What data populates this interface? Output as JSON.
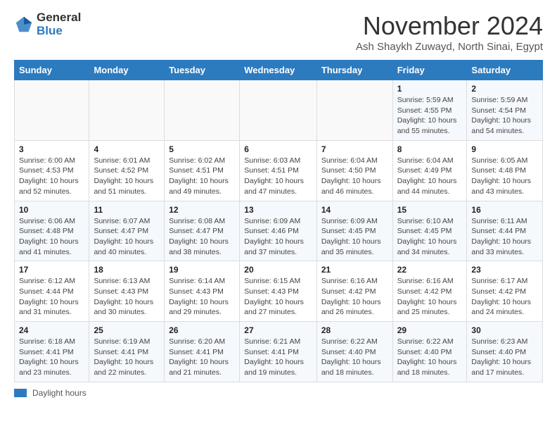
{
  "logo": {
    "general": "General",
    "blue": "Blue"
  },
  "title": "November 2024",
  "subtitle": "Ash Shaykh Zuwayd, North Sinai, Egypt",
  "weekdays": [
    "Sunday",
    "Monday",
    "Tuesday",
    "Wednesday",
    "Thursday",
    "Friday",
    "Saturday"
  ],
  "legend": {
    "box_label": "Daylight hours"
  },
  "weeks": [
    [
      {
        "day": "",
        "info": ""
      },
      {
        "day": "",
        "info": ""
      },
      {
        "day": "",
        "info": ""
      },
      {
        "day": "",
        "info": ""
      },
      {
        "day": "",
        "info": ""
      },
      {
        "day": "1",
        "info": "Sunrise: 5:59 AM\nSunset: 4:55 PM\nDaylight: 10 hours and 55 minutes."
      },
      {
        "day": "2",
        "info": "Sunrise: 5:59 AM\nSunset: 4:54 PM\nDaylight: 10 hours and 54 minutes."
      }
    ],
    [
      {
        "day": "3",
        "info": "Sunrise: 6:00 AM\nSunset: 4:53 PM\nDaylight: 10 hours and 52 minutes."
      },
      {
        "day": "4",
        "info": "Sunrise: 6:01 AM\nSunset: 4:52 PM\nDaylight: 10 hours and 51 minutes."
      },
      {
        "day": "5",
        "info": "Sunrise: 6:02 AM\nSunset: 4:51 PM\nDaylight: 10 hours and 49 minutes."
      },
      {
        "day": "6",
        "info": "Sunrise: 6:03 AM\nSunset: 4:51 PM\nDaylight: 10 hours and 47 minutes."
      },
      {
        "day": "7",
        "info": "Sunrise: 6:04 AM\nSunset: 4:50 PM\nDaylight: 10 hours and 46 minutes."
      },
      {
        "day": "8",
        "info": "Sunrise: 6:04 AM\nSunset: 4:49 PM\nDaylight: 10 hours and 44 minutes."
      },
      {
        "day": "9",
        "info": "Sunrise: 6:05 AM\nSunset: 4:48 PM\nDaylight: 10 hours and 43 minutes."
      }
    ],
    [
      {
        "day": "10",
        "info": "Sunrise: 6:06 AM\nSunset: 4:48 PM\nDaylight: 10 hours and 41 minutes."
      },
      {
        "day": "11",
        "info": "Sunrise: 6:07 AM\nSunset: 4:47 PM\nDaylight: 10 hours and 40 minutes."
      },
      {
        "day": "12",
        "info": "Sunrise: 6:08 AM\nSunset: 4:47 PM\nDaylight: 10 hours and 38 minutes."
      },
      {
        "day": "13",
        "info": "Sunrise: 6:09 AM\nSunset: 4:46 PM\nDaylight: 10 hours and 37 minutes."
      },
      {
        "day": "14",
        "info": "Sunrise: 6:09 AM\nSunset: 4:45 PM\nDaylight: 10 hours and 35 minutes."
      },
      {
        "day": "15",
        "info": "Sunrise: 6:10 AM\nSunset: 4:45 PM\nDaylight: 10 hours and 34 minutes."
      },
      {
        "day": "16",
        "info": "Sunrise: 6:11 AM\nSunset: 4:44 PM\nDaylight: 10 hours and 33 minutes."
      }
    ],
    [
      {
        "day": "17",
        "info": "Sunrise: 6:12 AM\nSunset: 4:44 PM\nDaylight: 10 hours and 31 minutes."
      },
      {
        "day": "18",
        "info": "Sunrise: 6:13 AM\nSunset: 4:43 PM\nDaylight: 10 hours and 30 minutes."
      },
      {
        "day": "19",
        "info": "Sunrise: 6:14 AM\nSunset: 4:43 PM\nDaylight: 10 hours and 29 minutes."
      },
      {
        "day": "20",
        "info": "Sunrise: 6:15 AM\nSunset: 4:43 PM\nDaylight: 10 hours and 27 minutes."
      },
      {
        "day": "21",
        "info": "Sunrise: 6:16 AM\nSunset: 4:42 PM\nDaylight: 10 hours and 26 minutes."
      },
      {
        "day": "22",
        "info": "Sunrise: 6:16 AM\nSunset: 4:42 PM\nDaylight: 10 hours and 25 minutes."
      },
      {
        "day": "23",
        "info": "Sunrise: 6:17 AM\nSunset: 4:42 PM\nDaylight: 10 hours and 24 minutes."
      }
    ],
    [
      {
        "day": "24",
        "info": "Sunrise: 6:18 AM\nSunset: 4:41 PM\nDaylight: 10 hours and 23 minutes."
      },
      {
        "day": "25",
        "info": "Sunrise: 6:19 AM\nSunset: 4:41 PM\nDaylight: 10 hours and 22 minutes."
      },
      {
        "day": "26",
        "info": "Sunrise: 6:20 AM\nSunset: 4:41 PM\nDaylight: 10 hours and 21 minutes."
      },
      {
        "day": "27",
        "info": "Sunrise: 6:21 AM\nSunset: 4:41 PM\nDaylight: 10 hours and 19 minutes."
      },
      {
        "day": "28",
        "info": "Sunrise: 6:22 AM\nSunset: 4:40 PM\nDaylight: 10 hours and 18 minutes."
      },
      {
        "day": "29",
        "info": "Sunrise: 6:22 AM\nSunset: 4:40 PM\nDaylight: 10 hours and 18 minutes."
      },
      {
        "day": "30",
        "info": "Sunrise: 6:23 AM\nSunset: 4:40 PM\nDaylight: 10 hours and 17 minutes."
      }
    ]
  ]
}
